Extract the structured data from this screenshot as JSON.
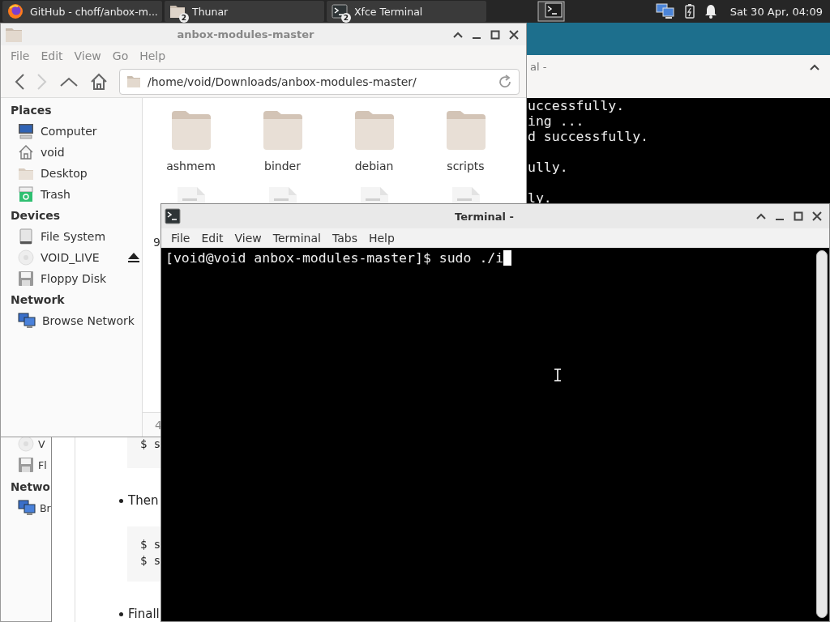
{
  "panel": {
    "tasks": [
      {
        "label": "GitHub - choff/anbox-m...",
        "kind": "browser"
      },
      {
        "label": "Thunar",
        "kind": "folder",
        "badge": "2"
      },
      {
        "label": "Xfce Terminal",
        "kind": "terminal",
        "badge": "2"
      }
    ],
    "clock": "Sat 30 Apr, 04:09"
  },
  "back_file_manager": {
    "sidebar": [
      {
        "label": "V",
        "kind": "disc"
      },
      {
        "label": "Fl",
        "kind": "floppy"
      },
      {
        "label": "Netwo",
        "kind": "heading"
      },
      {
        "label": "Br",
        "kind": "network"
      }
    ]
  },
  "browser_page": {
    "blocks": [
      {
        "kind": "code",
        "lines": [
          "$ s"
        ]
      },
      {
        "kind": "bullet",
        "text": "Then"
      },
      {
        "kind": "code",
        "lines": [
          "$ s",
          "$ s"
        ]
      },
      {
        "kind": "bullet",
        "text": "Finall"
      }
    ]
  },
  "back_terminal": {
    "title": "al -",
    "lines": [
      {
        "text": "uccessfully.",
        "blank_before": false
      },
      {
        "text": "ing ...",
        "blank_before": false
      },
      {
        "text": "d successfully.",
        "blank_before": false
      },
      {
        "text": "ully.",
        "blank_before": true
      },
      {
        "text": "ly.",
        "blank_before": true
      }
    ]
  },
  "file_manager": {
    "title": "anbox-modules-master",
    "menu": [
      "File",
      "Edit",
      "View",
      "Go",
      "Help"
    ],
    "location": "/home/void/Downloads/anbox-modules-master/",
    "sidebar": [
      {
        "heading": "Places",
        "items": [
          {
            "label": "Computer",
            "kind": "computer",
            "eject": false
          },
          {
            "label": "void",
            "kind": "home",
            "eject": false
          },
          {
            "label": "Desktop",
            "kind": "desktop",
            "eject": false
          },
          {
            "label": "Trash",
            "kind": "trash",
            "eject": false
          }
        ]
      },
      {
        "heading": "Devices",
        "items": [
          {
            "label": "File System",
            "kind": "drive",
            "eject": false
          },
          {
            "label": "VOID_LIVE",
            "kind": "disc",
            "eject": true
          },
          {
            "label": "Floppy Disk",
            "kind": "floppy",
            "eject": false
          }
        ]
      },
      {
        "heading": "Network",
        "items": [
          {
            "label": "Browse Network",
            "kind": "network",
            "eject": false
          }
        ]
      }
    ],
    "files": [
      {
        "name": "ashmem",
        "kind": "folder"
      },
      {
        "name": "binder",
        "kind": "folder"
      },
      {
        "name": "debian",
        "kind": "folder"
      },
      {
        "name": "scripts",
        "kind": "folder"
      },
      {
        "name": "9",
        "kind": "file"
      },
      {
        "kind": "file"
      },
      {
        "kind": "file"
      },
      {
        "kind": "file"
      }
    ],
    "status_text": "4"
  },
  "terminal": {
    "title": "Terminal -",
    "menu": [
      "File",
      "Edit",
      "View",
      "Terminal",
      "Tabs",
      "Help"
    ],
    "lines": [
      "[void@void anbox-modules-master]$ sudo ./i"
    ]
  }
}
